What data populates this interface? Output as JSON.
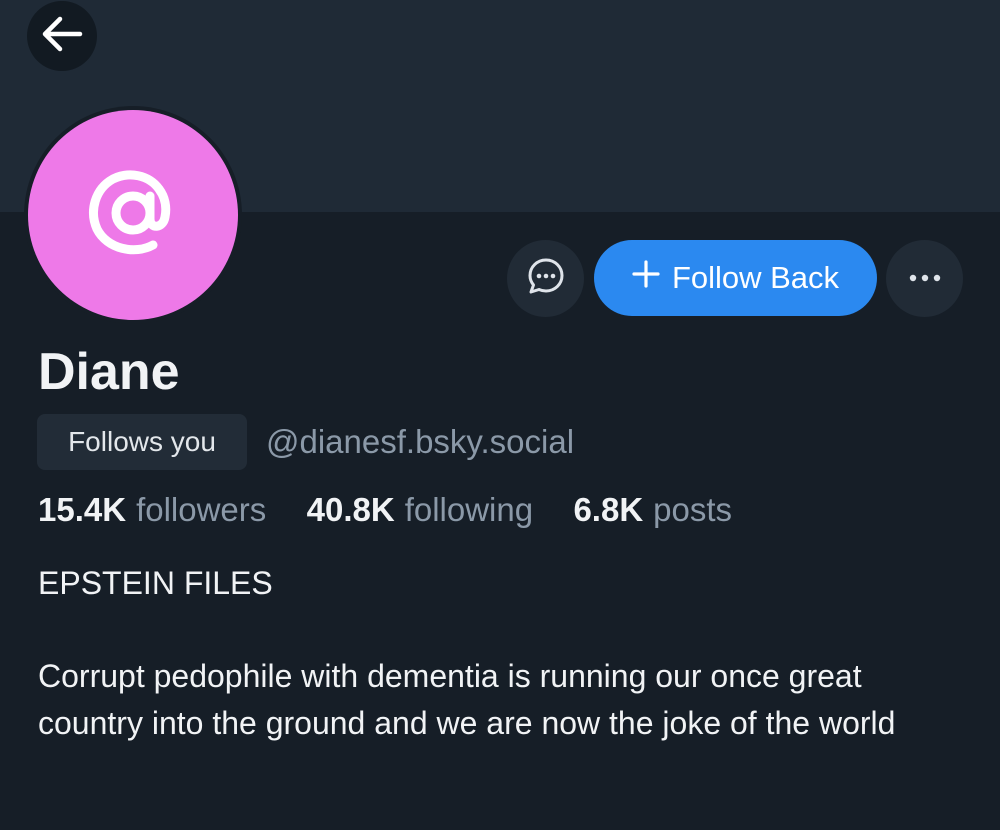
{
  "profile": {
    "display_name": "Diane",
    "handle": "@dianesf.bsky.social",
    "relationship_badge": "Follows you",
    "avatar_icon": "at-sign-icon",
    "avatar_color": "#ee79e8"
  },
  "actions": {
    "back_icon": "arrow-left-icon",
    "message_icon": "chat-bubble-icon",
    "follow_label": "Follow Back",
    "follow_icon": "plus-icon",
    "more_icon": "ellipsis-icon",
    "follow_color": "#2b89f0"
  },
  "stats": {
    "followers_count": "15.4K",
    "followers_label": "followers",
    "following_count": "40.8K",
    "following_label": "following",
    "posts_count": "6.8K",
    "posts_label": "posts"
  },
  "bio": {
    "title": "EPSTEIN FILES",
    "text": "Corrupt pedophile with dementia is running our once great country into the ground and we are now the joke of the world"
  }
}
